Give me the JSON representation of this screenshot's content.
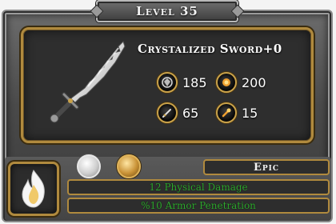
{
  "header": {
    "level_label": "Level 35"
  },
  "item": {
    "name": "Crystalized Sword+0",
    "icon": "sword-icon"
  },
  "stats": [
    {
      "icon": "shield-emblem-icon",
      "value": "185"
    },
    {
      "icon": "fire-orb-icon",
      "value": "200"
    },
    {
      "icon": "dagger-icon",
      "value": "65"
    },
    {
      "icon": "flame-burst-icon",
      "value": "15"
    }
  ],
  "bottom": {
    "element_icon": "white-flame-icon",
    "badges": [
      "silver-crest-icon",
      "gold-crest-icon"
    ],
    "rarity": "Epic",
    "effects": [
      "12 Physical Damage",
      "%10 Armor Penetration"
    ]
  },
  "colors": {
    "accent_gold": "#b08a3e",
    "effect_green": "#2fa82f",
    "panel_dark": "#2e2e2e"
  }
}
